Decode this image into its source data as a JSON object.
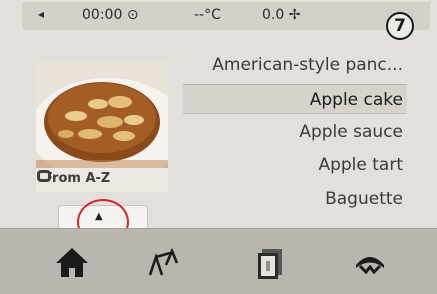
{
  "status_bar": {
    "back_icon": "left-arrow-icon",
    "time": "00:00",
    "time_icon": "clock-icon",
    "temperature": "--°C",
    "weight": "0.0",
    "weight_icon": "scale-icon"
  },
  "step_badge": "7",
  "thumbnail": {
    "image": "apple-cake-photo",
    "label": "From A-Z",
    "label_icon": "recipe-card-icon"
  },
  "recipes": [
    {
      "label": "American-style panc..."
    },
    {
      "label": "Apple cake",
      "selected": true
    },
    {
      "label": "Apple sauce"
    },
    {
      "label": "Apple tart"
    },
    {
      "label": "Baguette"
    }
  ],
  "scroll_up": {
    "icon": "up-arrow-icon"
  },
  "bottom_nav": [
    {
      "name": "home",
      "icon": "home-icon"
    },
    {
      "name": "scale",
      "icon": "scale-icon"
    },
    {
      "name": "recipes",
      "icon": "recipe-book-icon"
    },
    {
      "name": "mode",
      "icon": "turbo-mode-icon"
    }
  ],
  "colors": {
    "annotation": "#d3262b"
  }
}
